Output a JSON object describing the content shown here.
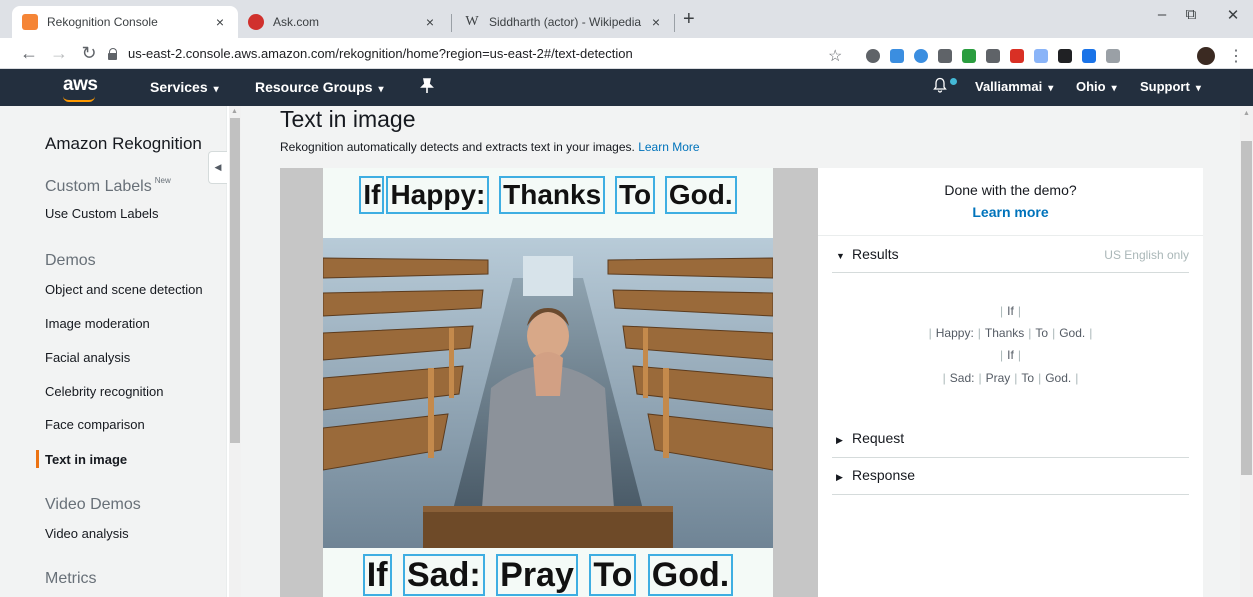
{
  "browser": {
    "tabs": [
      {
        "title": "Rekognition Console",
        "favicon": "aws-cube-icon",
        "color": "#f58536"
      },
      {
        "title": "Ask.com",
        "favicon": "ask-icon",
        "color": "#d0312d"
      },
      {
        "title": "Siddharth (actor) - Wikipedia",
        "favicon": "wikipedia-icon",
        "color": "#3c4043"
      }
    ],
    "tab_close": "×",
    "new_tab": "+",
    "window_controls": {
      "minimize": "–",
      "maximize": "⧉",
      "close": "✕"
    },
    "url": "us-east-2.console.aws.amazon.com/rekognition/home?region=us-east-2#/text-detection",
    "extensions": [
      "#5f6368",
      "#3b8ee0",
      "#3b8ee0",
      "#5f6368",
      "#2a9d3f",
      "#5f6368",
      "#d93025",
      "#8ab4f8",
      "#202124",
      "#1a73e8",
      "#9aa0a6"
    ]
  },
  "aws_nav": {
    "logo": "aws",
    "services": "Services",
    "resource_groups": "Resource Groups",
    "user": "Valliammai",
    "region": "Ohio",
    "support": "Support",
    "accent": "#ff9900"
  },
  "sidebar": {
    "title": "Amazon Rekognition",
    "custom_labels_heading": "Custom Labels",
    "new_badge": "New",
    "use_custom_labels": "Use Custom Labels",
    "demos_heading": "Demos",
    "demos": [
      "Object and scene detection",
      "Image moderation",
      "Facial analysis",
      "Celebrity recognition",
      "Face comparison",
      "Text in image"
    ],
    "video_heading": "Video Demos",
    "video_analysis": "Video analysis",
    "metrics_heading": "Metrics"
  },
  "main": {
    "title": "Text in image",
    "description": "Rekognition automatically detects and extracts text in your images.",
    "learn_more_link": "Learn More",
    "poster": {
      "top_words": [
        "If",
        "Happy:",
        "Thanks",
        "To",
        "God."
      ],
      "bottom_words": [
        "If",
        "Sad:",
        "Pray",
        "To",
        "God."
      ]
    }
  },
  "right_panel": {
    "done_text": "Done with the demo?",
    "learn_more": "Learn more",
    "results_label": "Results",
    "us_english": "US English only",
    "result_lines": [
      [
        "If"
      ],
      [
        "Happy:",
        "Thanks",
        "To",
        "God."
      ],
      [
        "If"
      ],
      [
        "Sad:",
        "Pray",
        "To",
        "God."
      ]
    ],
    "request_label": "Request",
    "response_label": "Response"
  }
}
